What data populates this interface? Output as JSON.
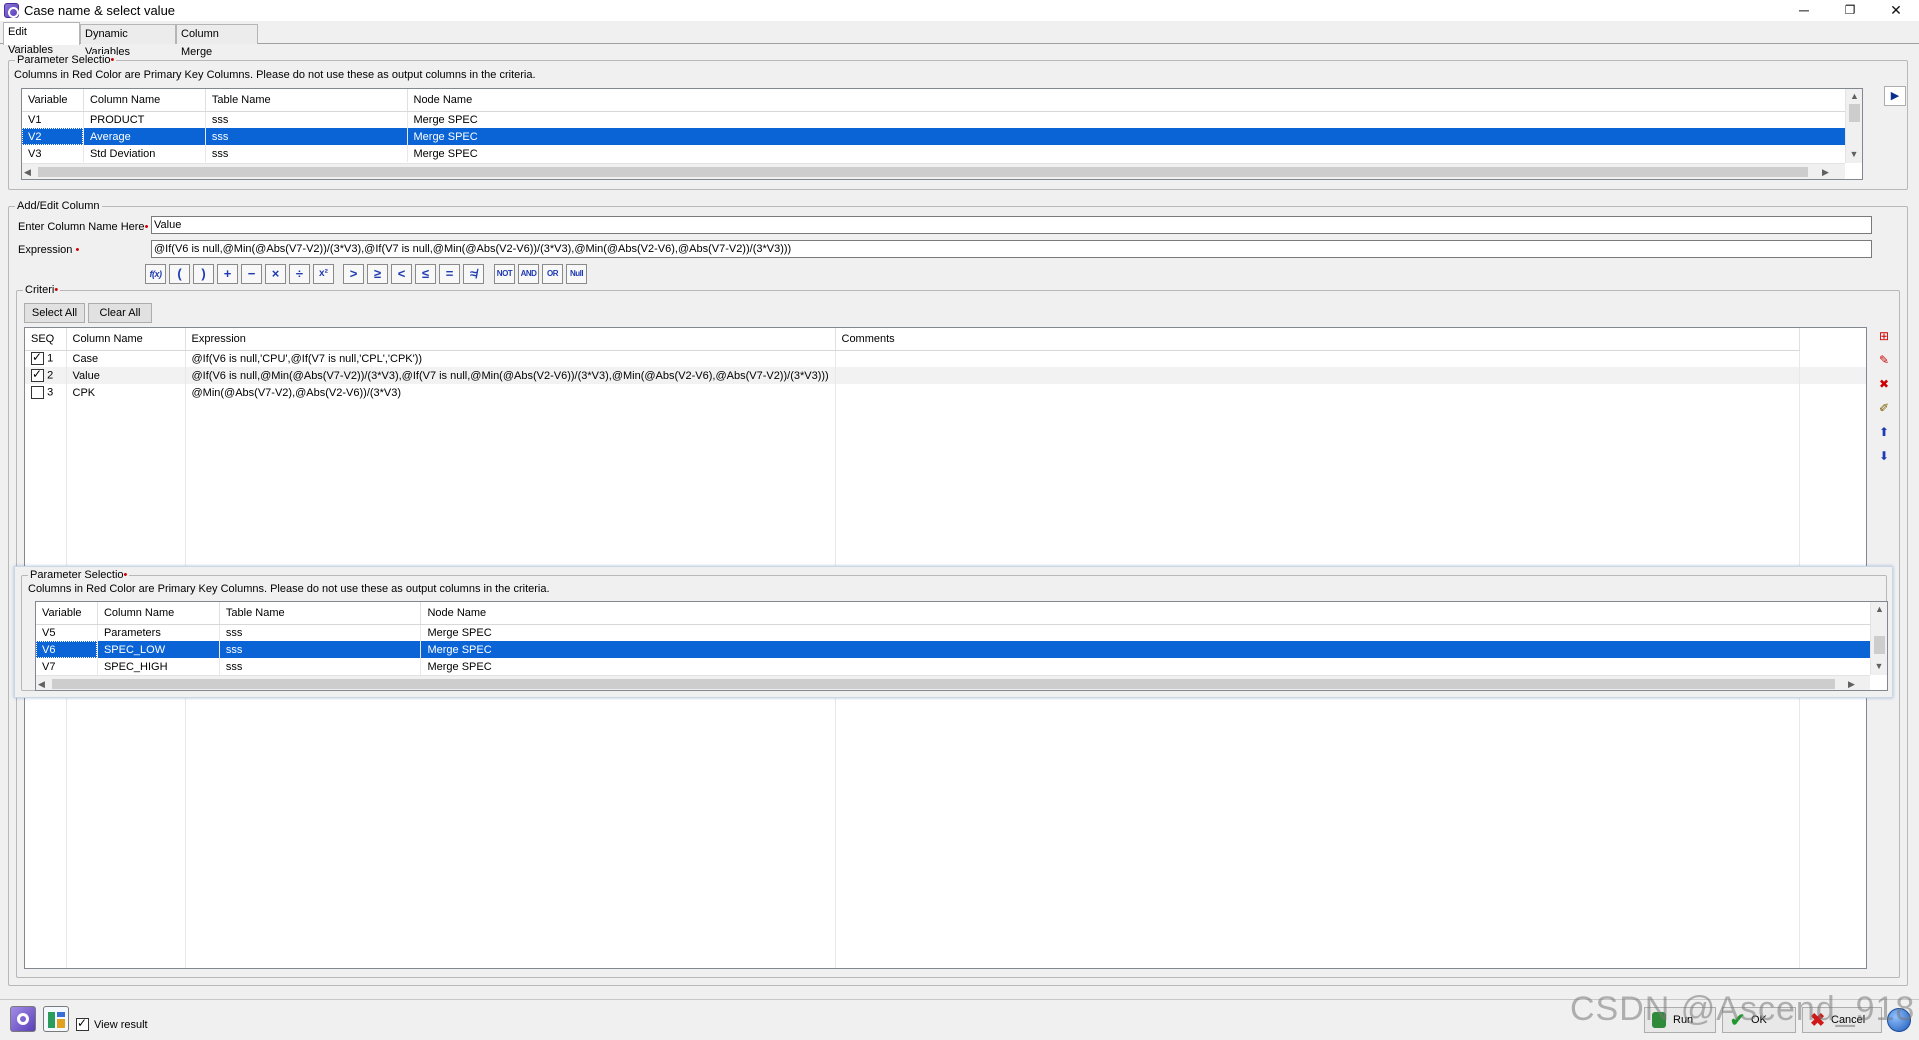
{
  "window": {
    "title": "Case name & select value",
    "controls": {
      "minimize": "─",
      "restore": "❐",
      "close": "✕"
    }
  },
  "tabs": [
    {
      "label": "Edit Variables",
      "active": true
    },
    {
      "label": "Dynamic Variables",
      "active": false
    },
    {
      "label": "Column Merge",
      "active": false
    }
  ],
  "param_top": {
    "legend": "Parameter Selectio",
    "note": "Columns in Red Color are Primary Key Columns. Please do not use these as output columns in the criteria.",
    "columns": [
      "Variable",
      "Column Name",
      "Table Name",
      "Node Name"
    ],
    "rows": [
      {
        "variable": "V1",
        "column": "PRODUCT",
        "table": "sss",
        "node": "Merge SPEC",
        "selected": false
      },
      {
        "variable": "V2",
        "column": "Average",
        "table": "sss",
        "node": "Merge SPEC",
        "selected": true
      },
      {
        "variable": "V3",
        "column": "Std Deviation",
        "table": "sss",
        "node": "Merge SPEC",
        "selected": false
      }
    ],
    "expand_arrow": "▶"
  },
  "add_edit": {
    "legend": "Add/Edit Column",
    "name_label": "Enter Column Name Here",
    "name_value": "Value",
    "expr_label": "Expression",
    "expr_value": "@If(V6 is null,@Min(@Abs(V7-V2))/(3*V3),@If(V7 is null,@Min(@Abs(V2-V6))/(3*V3),@Min(@Abs(V2-V6),@Abs(V7-V2))/(3*V3)))"
  },
  "operators": {
    "fx": "f(x)",
    "lparen": "(",
    "rparen": ")",
    "plus": "+",
    "minus": "−",
    "times": "×",
    "divide": "÷",
    "power": "x²",
    "gt": ">",
    "ge": "≥",
    "lt": "<",
    "le": "≤",
    "eq": "=",
    "ne": "≉",
    "not": "NOT",
    "and": "AND",
    "or": "OR",
    "null": "Null"
  },
  "criteria": {
    "legend": "Criteri",
    "select_all": "Select All",
    "clear_all": "Clear All",
    "columns": [
      "SEQ",
      "Column Name",
      "Expression",
      "Comments"
    ],
    "rows": [
      {
        "checked": true,
        "seq": "1",
        "column": "Case",
        "expression": "@If(V6 is null,'CPU',@If(V7 is null,'CPL','CPK'))",
        "comments": ""
      },
      {
        "checked": true,
        "seq": "2",
        "column": "Value",
        "expression": "@If(V6 is null,@Min(@Abs(V7-V2))/(3*V3),@If(V7 is null,@Min(@Abs(V2-V6))/(3*V3),@Min(@Abs(V2-V6),@Abs(V7-V2))/(3*V3)))",
        "comments": ""
      },
      {
        "checked": false,
        "seq": "3",
        "column": "CPK",
        "expression": "@Min(@Abs(V7-V2),@Abs(V2-V6))/(3*V3)",
        "comments": ""
      }
    ]
  },
  "param_popup": {
    "legend": "Parameter Selectio",
    "note": "Columns in Red Color are Primary Key Columns. Please do not use these as output columns in the criteria.",
    "columns": [
      "Variable",
      "Column Name",
      "Table Name",
      "Node Name"
    ],
    "rows": [
      {
        "variable": "V5",
        "column": "Parameters",
        "table": "sss",
        "node": "Merge SPEC",
        "selected": false
      },
      {
        "variable": "V6",
        "column": "SPEC_LOW",
        "table": "sss",
        "node": "Merge SPEC",
        "selected": true
      },
      {
        "variable": "V7",
        "column": "SPEC_HIGH",
        "table": "sss",
        "node": "Merge SPEC",
        "selected": false
      }
    ]
  },
  "bottom": {
    "view_result": "View result",
    "run": "Run",
    "ok": "OK",
    "cancel": "Cancel",
    "watermark": "CSDN @Ascend_918"
  },
  "colors": {
    "selection": "#0a64d6",
    "required": "#cc0000",
    "operator": "#1f3bb3"
  }
}
